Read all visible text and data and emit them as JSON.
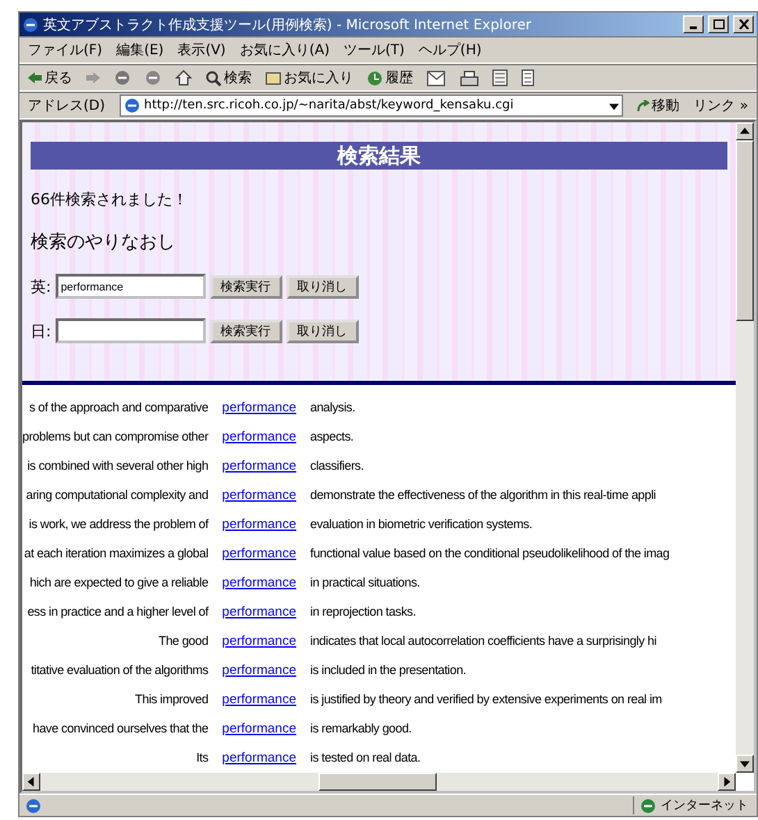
{
  "window": {
    "title": "英文アブストラクト作成支援ツール(用例検索) - Microsoft Internet Explorer"
  },
  "menu": [
    "ファイル(F)",
    "編集(E)",
    "表示(V)",
    "お気に入り(A)",
    "ツール(T)",
    "ヘルプ(H)"
  ],
  "toolbar": {
    "back": "戻る",
    "search": "検索",
    "favorites": "お気に入り",
    "history": "履歴"
  },
  "address": {
    "label": "アドレス(D)",
    "url": "http://ten.src.ricoh.co.jp/~narita/abst/keyword_kensaku.cgi",
    "go": "移動",
    "links": "リンク »"
  },
  "page": {
    "heading": "検索結果",
    "count": "66件検索されました！",
    "subheading": "検索のやりなおし",
    "forms": [
      {
        "label": "英:",
        "value": "performance",
        "submit": "検索実行",
        "clear": "取り消し"
      },
      {
        "label": "日:",
        "submit": "検索実行",
        "clear": "取り消し"
      }
    ]
  },
  "results": [
    {
      "before": "s of the approach and comparative",
      "keyword": "performance",
      "after": "analysis."
    },
    {
      "before": "problems but can compromise other",
      "keyword": "performance",
      "after": "aspects."
    },
    {
      "before": "is combined with several other high",
      "keyword": "performance",
      "after": "classifiers."
    },
    {
      "before": "aring computational complexity and",
      "keyword": "performance",
      "after": "demonstrate the effectiveness of the algorithm in this real-time appli"
    },
    {
      "before": "is work, we address the problem of",
      "keyword": "performance",
      "after": "evaluation in biometric verification systems."
    },
    {
      "before": "at each iteration maximizes a global",
      "keyword": "performance",
      "after": "functional value based on the conditional pseudolikelihood of the imag"
    },
    {
      "before": "hich are expected to give a reliable",
      "keyword": "performance",
      "after": "in practical situations."
    },
    {
      "before": "ess in practice and a higher level of",
      "keyword": "performance",
      "after": "in reprojection tasks."
    },
    {
      "before": "The good",
      "keyword": "performance",
      "after": "indicates that local autocorrelation coefficients have a surprisingly hi"
    },
    {
      "before": "titative evaluation of the algorithms",
      "keyword": "performance",
      "after": "is included in the presentation."
    },
    {
      "before": "This improved",
      "keyword": "performance",
      "after": "is justified by theory and verified by extensive experiments on real im"
    },
    {
      "before": "have convinced ourselves that the",
      "keyword": "performance",
      "after": "is remarkably good."
    },
    {
      "before": "Its",
      "keyword": "performance",
      "after": "is tested on real data."
    }
  ],
  "status_bar": {
    "zone": "インターネット"
  }
}
